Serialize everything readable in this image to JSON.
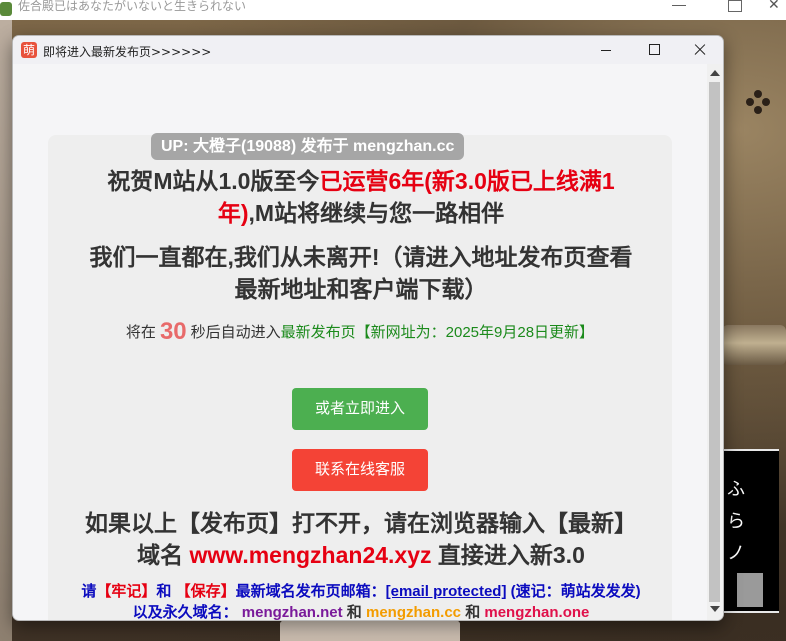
{
  "background_window": {
    "title": "佐合殿已はあなたがいないと生きられない"
  },
  "popup": {
    "icon_char": "萌",
    "title": "即将进入最新发布页>>>>>>"
  },
  "card": {
    "up_badge": "UP: 大橙子(19088) 发布于 mengzhan.cc",
    "headline_part1": "祝贺M站从1.0版至今",
    "headline_highlight": "已运营6年(新3.0版已上线满1年)",
    "headline_part2": ",M站将继续与您一路相伴",
    "subhead": "我们一直都在,我们从未离开!（请进入地址发布页查看最新地址和客户端下载）",
    "countdown_prefix": "将在",
    "countdown_seconds": "30",
    "countdown_middle": "秒后自动进入",
    "countdown_target": "最新发布页【新网址为：2025年9月28日更新】",
    "enter_button": "或者立即进入",
    "service_button": "联系在线客服",
    "footer_part1": "如果以上【发布页】打不开，请在浏览器输入【最新】域名",
    "footer_domain": "www.mengzhan24.xyz",
    "footer_part2": "直接进入新3.0",
    "notice": {
      "please": "请",
      "remember": "【牢记】",
      "and1": "和",
      "save": "【保存】",
      "text1": "最新域名发布页邮箱：",
      "email": "[email protected]",
      "text2": "(速记：萌站发发发) 以及永久域名：",
      "domain1": "mengzhan.net",
      "and2": "和",
      "domain2": "mengzhan.cc",
      "and3": "和",
      "domain3": "mengzhan.one"
    }
  },
  "colors": {
    "accent_red": "#e60012",
    "enter_green": "#4caf50",
    "service_red": "#f44336",
    "countdown_green": "#1b8a1b",
    "notice_blue": "#0b0bbf"
  }
}
